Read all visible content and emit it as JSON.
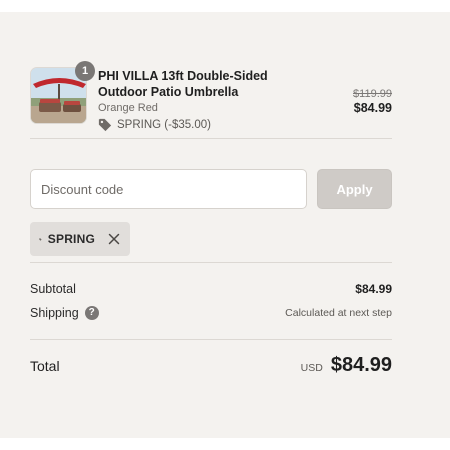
{
  "product": {
    "quantity": "1",
    "title": "PHI VILLA 13ft Double-Sided Outdoor Patio Umbrella",
    "variant": "Orange Red",
    "discount_label": "SPRING (-$35.00)",
    "original_price": "$119.99",
    "price": "$84.99",
    "image_icon": "patio-umbrella-thumbnail"
  },
  "discount": {
    "placeholder": "Discount code",
    "apply_label": "Apply",
    "applied_code": "SPRING",
    "tag_icon": "tag-icon",
    "remove_icon": "close-icon"
  },
  "summary": {
    "subtotal_label": "Subtotal",
    "subtotal_value": "$84.99",
    "shipping_label": "Shipping",
    "shipping_help": "?",
    "shipping_value": "Calculated at next step",
    "total_label": "Total",
    "currency": "USD",
    "total_value": "$84.99"
  },
  "colors": {
    "panel_bg": "#f4f2ef",
    "badge_bg": "#7a7775",
    "apply_disabled": "#cfcbc7",
    "umbrella_red": "#c0282d"
  }
}
